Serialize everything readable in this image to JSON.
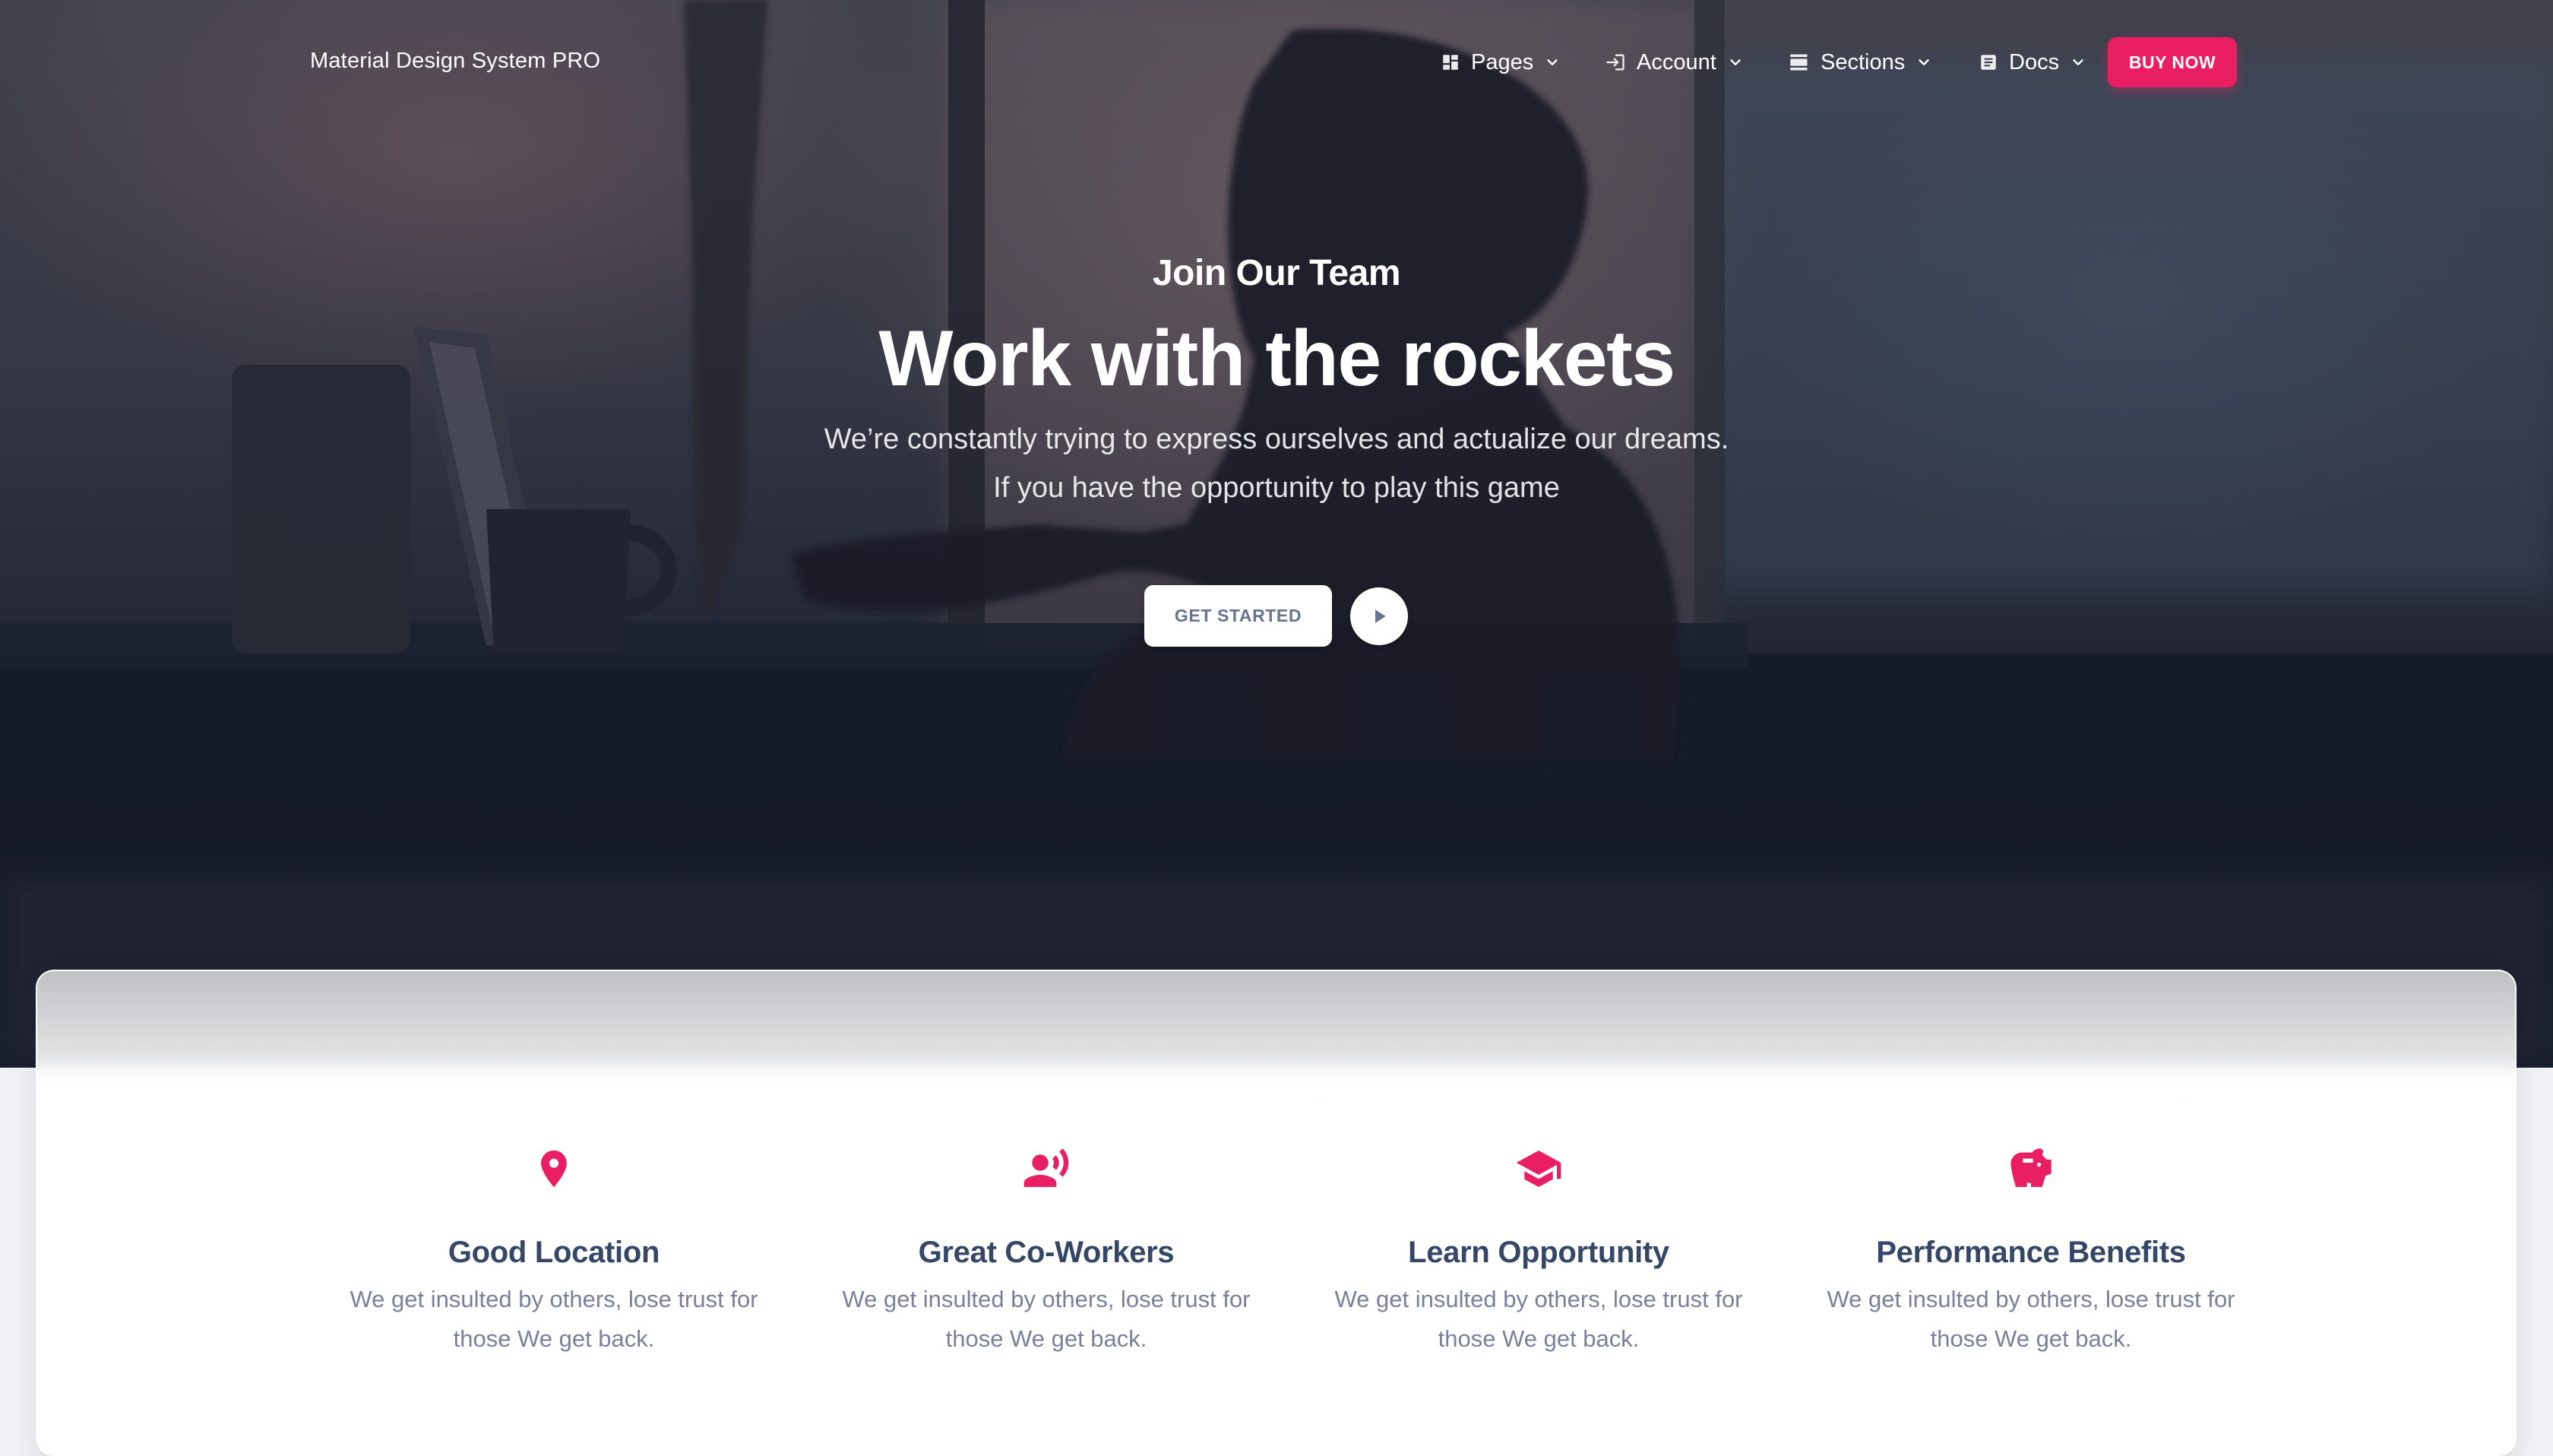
{
  "navbar": {
    "brand": "Material Design System PRO",
    "items": [
      {
        "label": "Pages",
        "icon": "dashboard-icon"
      },
      {
        "label": "Account",
        "icon": "login-icon"
      },
      {
        "label": "Sections",
        "icon": "view-day-icon"
      },
      {
        "label": "Docs",
        "icon": "article-icon"
      }
    ],
    "buy_now": "BUY NOW"
  },
  "hero": {
    "eyebrow": "Join Our Team",
    "title": "Work with the rockets",
    "lead_line1": "We’re constantly trying to express ourselves and actualize our dreams.",
    "lead_line2": "If you have the opportunity to play this game",
    "get_started": "GET STARTED",
    "play_icon": "play-icon"
  },
  "features": [
    {
      "icon": "location-pin-icon",
      "title": "Good Location",
      "line1": "We get insulted by others, lose trust for",
      "line2": "those We get back."
    },
    {
      "icon": "record-voice-icon",
      "title": "Great Co-Workers",
      "line1": "We get insulted by others, lose trust for",
      "line2": "those We get back."
    },
    {
      "icon": "school-icon",
      "title": "Learn Opportunity",
      "line1": "We get insulted by others, lose trust for",
      "line2": "those We get back."
    },
    {
      "icon": "savings-icon",
      "title": "Performance Benefits",
      "line1": "We get insulted by others, lose trust for",
      "line2": "those We get back."
    }
  ],
  "colors": {
    "accent": "#e91e63",
    "heading": "#344767",
    "body_text": "#7b809a"
  }
}
